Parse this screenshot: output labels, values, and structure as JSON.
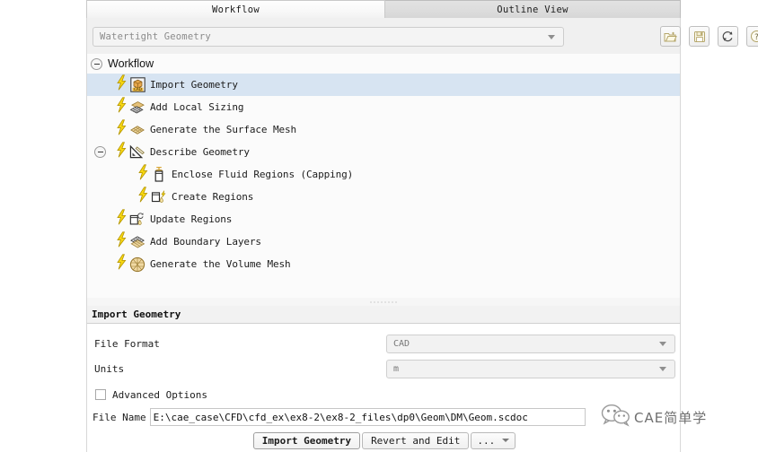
{
  "tabs": [
    {
      "label": "Workflow",
      "active": true
    },
    {
      "label": "Outline View",
      "active": false
    }
  ],
  "toolbar": {
    "workflow_type": "Watertight Geometry",
    "buttons": [
      {
        "name": "open-folder-icon",
        "title": "Load workflow"
      },
      {
        "name": "save-icon",
        "title": "Save workflow"
      },
      {
        "name": "reset-icon",
        "title": "Reset workflow"
      },
      {
        "name": "help-icon",
        "title": "Help"
      }
    ]
  },
  "tree": {
    "root_label": "Workflow",
    "items": [
      {
        "label": "Import Geometry",
        "indent": 0,
        "icon": "cad-box-icon",
        "selected": true,
        "expandable": false
      },
      {
        "label": "Add Local Sizing",
        "indent": 0,
        "icon": "local-sizing-icon",
        "selected": false,
        "expandable": false
      },
      {
        "label": "Generate the Surface Mesh",
        "indent": 0,
        "icon": "surface-mesh-icon",
        "selected": false,
        "expandable": false
      },
      {
        "label": "Describe Geometry",
        "indent": 0,
        "icon": "describe-geom-icon",
        "selected": false,
        "expandable": true
      },
      {
        "label": "Enclose Fluid Regions (Capping)",
        "indent": 1,
        "icon": "capping-icon",
        "selected": false,
        "expandable": false
      },
      {
        "label": "Create Regions",
        "indent": 1,
        "icon": "create-regions-icon",
        "selected": false,
        "expandable": false
      },
      {
        "label": "Update Regions",
        "indent": 0,
        "icon": "update-regions-icon",
        "selected": false,
        "expandable": false
      },
      {
        "label": "Add Boundary Layers",
        "indent": 0,
        "icon": "boundary-layer-icon",
        "selected": false,
        "expandable": false
      },
      {
        "label": "Generate the Volume Mesh",
        "indent": 0,
        "icon": "volume-mesh-icon",
        "selected": false,
        "expandable": false
      }
    ]
  },
  "properties": {
    "title": "Import Geometry",
    "file_format": {
      "label": "File Format",
      "value": "CAD"
    },
    "units": {
      "label": "Units",
      "value": "m"
    },
    "advanced_options": {
      "label": "Advanced Options",
      "checked": false
    },
    "file_name": {
      "label": "File Name",
      "value": "E:\\cae_case\\CFD\\cfd_ex\\ex8-2\\ex8-2_files\\dp0\\Geom\\DM\\Geom.scdoc"
    },
    "actions": [
      {
        "label": "Import Geometry",
        "primary": true
      },
      {
        "label": "Revert and Edit",
        "primary": false
      },
      {
        "label": "...",
        "primary": false,
        "has_caret": true
      }
    ]
  },
  "watermark": {
    "icon": "wechat-icon",
    "text": "CAE简单学"
  },
  "colors": {
    "selection": "#d7e4f2",
    "bolt": "#f7d513",
    "panel_bg": "#fbfbfb",
    "tab_active": "#f8f8f8",
    "tab_inactive": "#dcdcdc"
  }
}
